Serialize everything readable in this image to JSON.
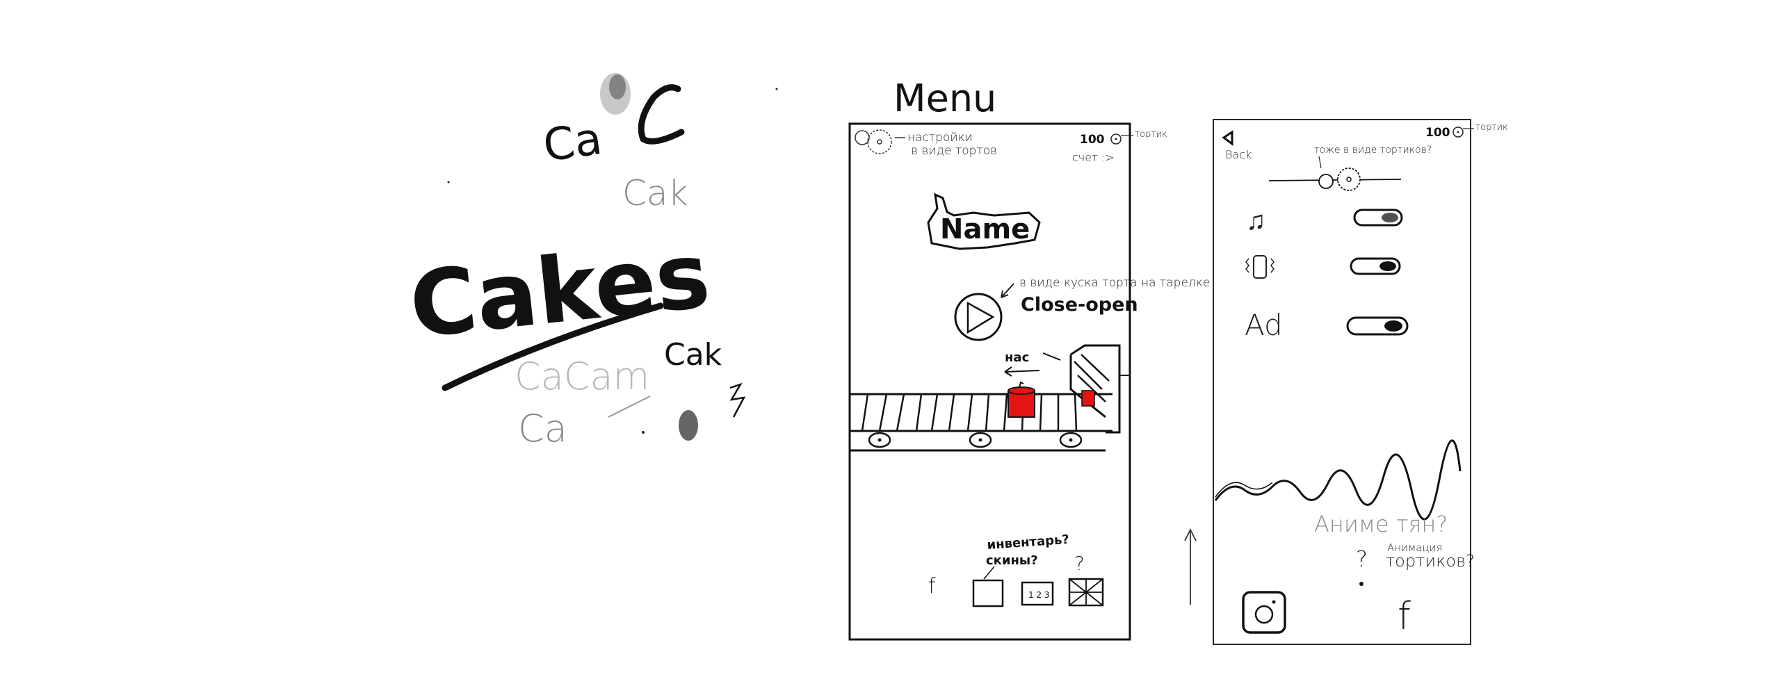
{
  "colors": {
    "ink": "#111111",
    "accent_red": "#e41414",
    "paper": "#ffffff",
    "grey_ink": "#8a8a8a"
  },
  "logo_sketches": {
    "main_word": "Cakes",
    "scribbles": [
      "Ca",
      "Cak",
      "Ca",
      "Cak",
      "CaCam",
      "Ca"
    ]
  },
  "menu_screen": {
    "title": "Menu",
    "settings_note_line1": "настройки",
    "settings_note_line2": "в виде тортов",
    "score_value": "100",
    "score_note": "тортик",
    "score_label": "счет :>",
    "name_plate": "Name",
    "play_note": "в виде куска торта на тарелке",
    "play_state": "Close-open",
    "conveyor_note": "нас",
    "bottom_note_line1": "инвентарь?",
    "bottom_note_line2": "скины?",
    "question_mark": "?",
    "facebook_glyph": "f",
    "skins_box_label": "1 2 3"
  },
  "settings_screen": {
    "back_label": "Back",
    "score_value": "100",
    "score_note": "тортик",
    "slider_note": "тоже в виде тортиков?",
    "toggles": [
      {
        "icon": "music-note-icon",
        "label": "♫",
        "state": "on"
      },
      {
        "icon": "vibration-icon",
        "label": "",
        "state": "on"
      },
      {
        "icon": "ads-icon",
        "label": "Ad",
        "state": "on"
      }
    ],
    "anime_note": "Аниме тян?",
    "anim_note_line1": "Анимация",
    "anim_note_line2": "тортиков?",
    "question_mark": "?",
    "instagram_glyph": "◉",
    "facebook_glyph": "f"
  }
}
